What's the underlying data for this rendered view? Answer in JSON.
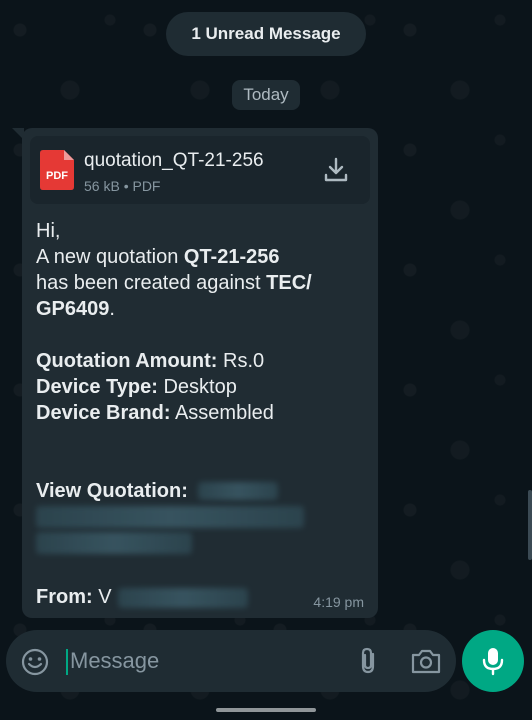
{
  "unread_banner": "1 Unread Message",
  "date_chip": "Today",
  "message": {
    "document": {
      "file_name": "quotation_QT-21-256",
      "meta": "56 kB • PDF",
      "icon_label": "PDF",
      "icon": "pdf-file-icon",
      "download_icon": "download-icon"
    },
    "greeting": "Hi,",
    "line1_prefix": "A new quotation ",
    "quote_id": "QT-21-256",
    "line2_prefix": "has been created against ",
    "target_a": "TEC/",
    "target_b": "GP6409",
    "line3_suffix": ".",
    "amount_label": "Quotation Amount:",
    "amount_value": " Rs.0",
    "device_type_label": "Device Type:",
    "device_type_value": " Desktop",
    "device_brand_label": "Device Brand:",
    "device_brand_value": " Assembled",
    "view_label": "View Quotation:",
    "from_label": "From:",
    "from_value": " V",
    "time": "4:19 pm"
  },
  "composer": {
    "placeholder": "Message",
    "emoji_icon": "emoji-icon",
    "attach_icon": "paperclip-icon",
    "camera_icon": "camera-icon",
    "mic_icon": "microphone-icon"
  },
  "colors": {
    "background": "#0b141a",
    "bubble": "#202c33",
    "accent": "#00a884",
    "pdf_red": "#e53935"
  }
}
